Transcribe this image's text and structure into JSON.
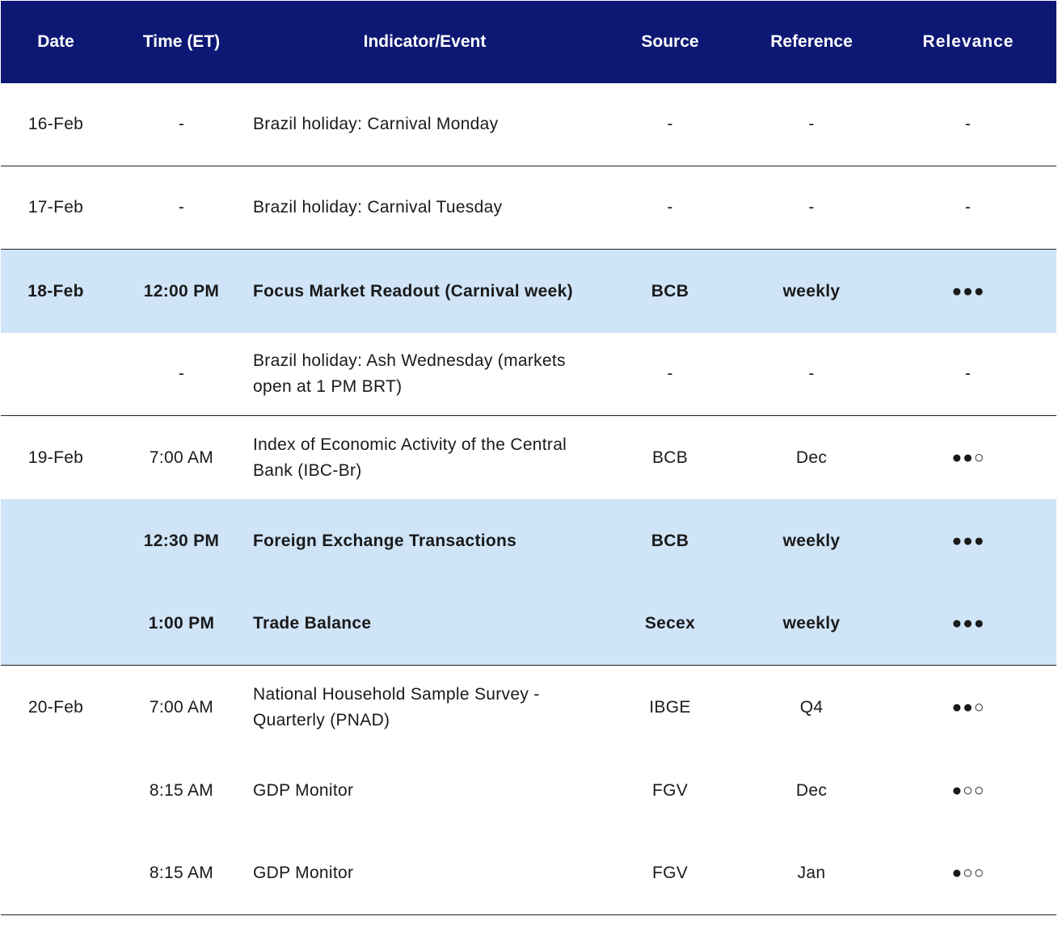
{
  "header": {
    "date": "Date",
    "time": "Time (ET)",
    "event": "Indicator/Event",
    "source": "Source",
    "reference": "Reference",
    "relevance": "Relevance"
  },
  "rows": [
    {
      "date": "16-Feb",
      "time": "-",
      "event": "Brazil holiday: Carnival Monday",
      "source": "-",
      "reference": "-",
      "relevance": "-"
    },
    {
      "date": "17-Feb",
      "time": "-",
      "event": "Brazil holiday: Carnival Tuesday",
      "source": "-",
      "reference": "-",
      "relevance": "-"
    },
    {
      "date": "18-Feb",
      "time": "12:00 PM",
      "event": "Focus Market Readout (Carnival week)",
      "source": "BCB",
      "reference": "weekly",
      "relevance": "●●●"
    },
    {
      "date": "",
      "time": "-",
      "event": "Brazil holiday: Ash Wednesday (markets open at 1 PM BRT)",
      "source": "-",
      "reference": "-",
      "relevance": "-"
    },
    {
      "date": "19-Feb",
      "time": "7:00 AM",
      "event": "Index of Economic Activity of the Central Bank (IBC-Br)",
      "source": "BCB",
      "reference": "Dec",
      "relevance": "●●○"
    },
    {
      "date": "",
      "time": "12:30 PM",
      "event": "Foreign Exchange Transactions",
      "source": "BCB",
      "reference": "weekly",
      "relevance": "●●●"
    },
    {
      "date": "",
      "time": "1:00 PM",
      "event": "Trade Balance",
      "source": "Secex",
      "reference": "weekly",
      "relevance": "●●●"
    },
    {
      "date": "20-Feb",
      "time": "7:00 AM",
      "event": "National Household Sample Survey - Quarterly (PNAD)",
      "source": "IBGE",
      "reference": "Q4",
      "relevance": "●●○"
    },
    {
      "date": "",
      "time": "8:15 AM",
      "event": "GDP Monitor",
      "source": "FGV",
      "reference": "Dec",
      "relevance": "●○○"
    },
    {
      "date": "",
      "time": "8:15 AM",
      "event": "GDP Monitor",
      "source": "FGV",
      "reference": "Jan",
      "relevance": "●○○"
    }
  ],
  "colors": {
    "header_bg": "#0d1874",
    "highlight_bg": "#cfe4f7"
  }
}
